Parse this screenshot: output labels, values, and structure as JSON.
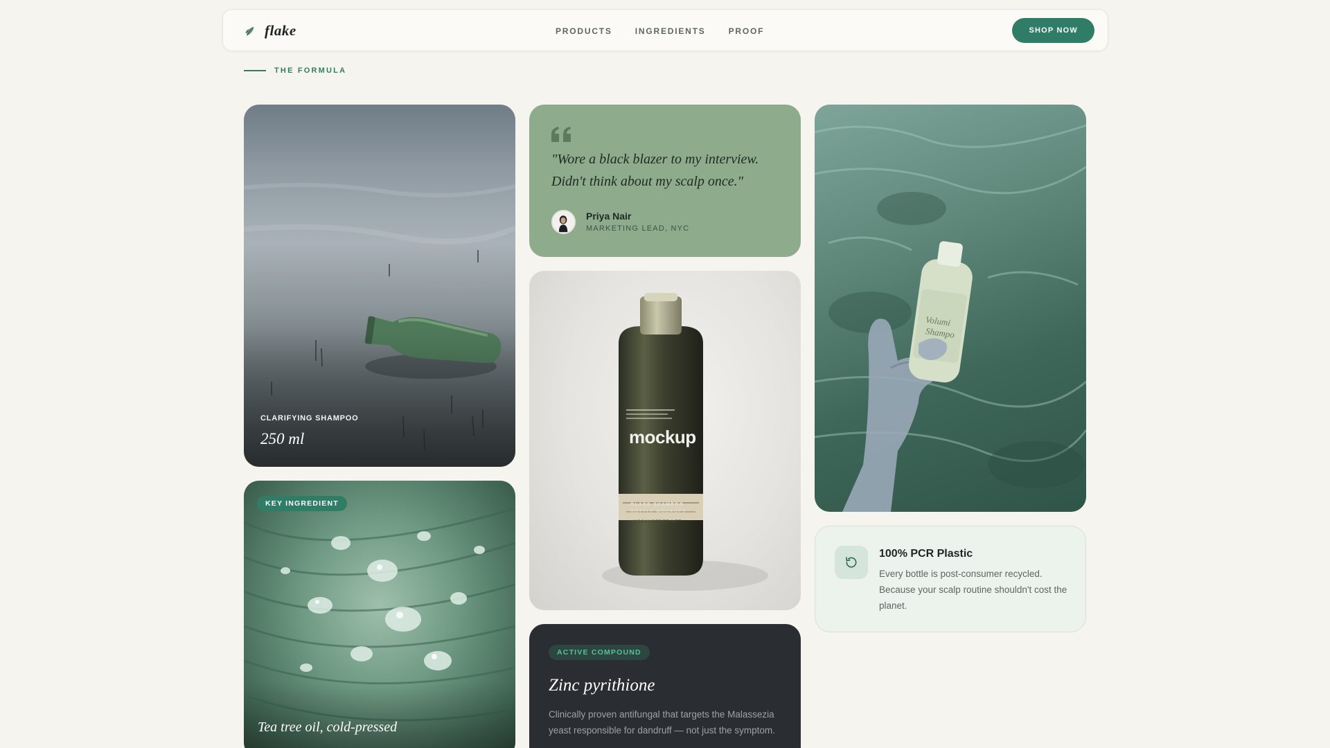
{
  "header": {
    "brand": "flake",
    "brand_icon": "leaf-icon",
    "nav": [
      "PRODUCTS",
      "INGREDIENTS",
      "PROOF"
    ],
    "cta": "SHOP NOW"
  },
  "section": {
    "label": "THE FORMULA"
  },
  "cards": {
    "lake": {
      "eyebrow": "CLARIFYING SHAMPOO",
      "volume": "250 ml"
    },
    "leaf": {
      "badge": "KEY INGREDIENT",
      "caption": "Tea tree oil, cold-pressed"
    },
    "quote": {
      "icon": "quote-icon",
      "text": "\"Wore a black blazer to my interview. Didn't think about my scalp once.\"",
      "author": "Priya Nair",
      "role": "MARKETING LEAD, NYC"
    },
    "bottle": {
      "brand_mark": "mockup",
      "label_line1": "GLASS SHAMPOO",
      "label_line2": "BOTTLE MOCKUPS",
      "label_line3": "MOCKUPFREE.NET"
    },
    "compound": {
      "badge": "ACTIVE COMPOUND",
      "title": "Zinc pyrithione",
      "desc": "Clinically proven antifungal that targets the Malassezia yeast responsible for dandruff — not just the symptom."
    },
    "water": {
      "bottle_text1": "Volumi",
      "bottle_text2": "Shampo"
    },
    "pcr": {
      "icon": "refresh-icon",
      "title": "100% PCR Plastic",
      "desc": "Every bottle is post-consumer recycled. Because your scalp routine shouldn't cost the planet."
    }
  },
  "colors": {
    "accent": "#2f7d66",
    "background": "#f6f4ef",
    "quote_card": "#8eab8c",
    "dark_card": "#2a2d31",
    "pcr_card": "#ecf2ec"
  }
}
